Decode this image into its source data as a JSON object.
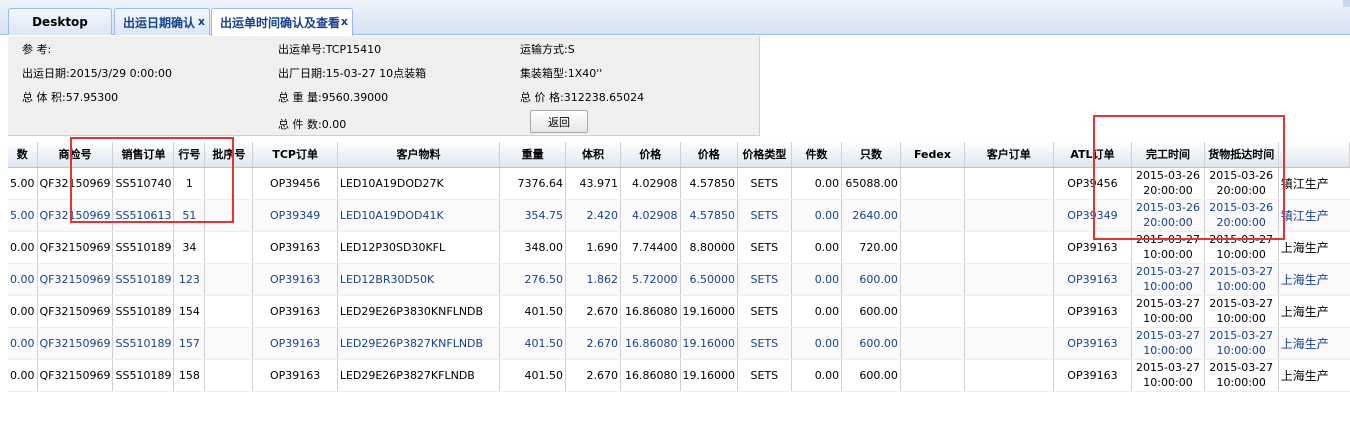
{
  "tabs": [
    {
      "label": "Desktop"
    },
    {
      "label": "出运日期确认",
      "close": "x"
    },
    {
      "label": "出运单时间确认及查看",
      "close": "x"
    }
  ],
  "info": {
    "ref_label": "参      考:",
    "ship_date": "出运日期:2015/3/29 0:00:00",
    "total_volume": "总 体 积:57.95300",
    "shipment_no": "出运单号:TCP15410",
    "factory_date": "出厂日期:15-03-27 10点装箱",
    "total_weight": "总 重 量:9560.39000",
    "total_pieces": "总 件 数:0.00",
    "transport": "运输方式:S",
    "container": "集装箱型:1X40''",
    "total_price": "总 价 格:312238.65024",
    "back_button": "返回"
  },
  "grid": {
    "headers": [
      "数",
      "商检号",
      "销售订单",
      "行号",
      "批序号",
      "TCP订单",
      "客户物料",
      "重量",
      "体积",
      "价格",
      "价格",
      "价格类型",
      "件数",
      "只数",
      "Fedex",
      "客户订单",
      "ATL订单",
      "完工时间",
      "货物抵达时间",
      ""
    ],
    "rows": [
      [
        "5.00",
        "QF32150969",
        "SS510740",
        "1",
        "",
        "OP39456",
        "LED10A19DOD27K",
        "7376.64",
        "43.971",
        "4.02908",
        "4.57850",
        "SETS",
        "0.00",
        "65088.00",
        "",
        "",
        "OP39456",
        "2015-03-26 20:00:00",
        "2015-03-26 20:00:00",
        "镇江生产"
      ],
      [
        "5.00",
        "QF32150969",
        "SS510613",
        "51",
        "",
        "OP39349",
        "LED10A19DOD41K",
        "354.75",
        "2.420",
        "4.02908",
        "4.57850",
        "SETS",
        "0.00",
        "2640.00",
        "",
        "",
        "OP39349",
        "2015-03-26 20:00:00",
        "2015-03-26 20:00:00",
        "镇江生产"
      ],
      [
        "0.00",
        "QF32150969",
        "SS510189",
        "34",
        "",
        "OP39163",
        "LED12P30SD30KFL",
        "348.00",
        "1.690",
        "7.74400",
        "8.80000",
        "SETS",
        "0.00",
        "720.00",
        "",
        "",
        "OP39163",
        "2015-03-27 10:00:00",
        "2015-03-27 10:00:00",
        "上海生产"
      ],
      [
        "0.00",
        "QF32150969",
        "SS510189",
        "123",
        "",
        "OP39163",
        "LED12BR30D50K",
        "276.50",
        "1.862",
        "5.72000",
        "6.50000",
        "SETS",
        "0.00",
        "600.00",
        "",
        "",
        "OP39163",
        "2015-03-27 10:00:00",
        "2015-03-27 10:00:00",
        "上海生产"
      ],
      [
        "0.00",
        "QF32150969",
        "SS510189",
        "154",
        "",
        "OP39163",
        "LED29E26P3830KNFLNDB",
        "401.50",
        "2.670",
        "16.86080",
        "19.16000",
        "SETS",
        "0.00",
        "600.00",
        "",
        "",
        "OP39163",
        "2015-03-27 10:00:00",
        "2015-03-27 10:00:00",
        "上海生产"
      ],
      [
        "0.00",
        "QF32150969",
        "SS510189",
        "157",
        "",
        "OP39163",
        "LED29E26P3827KNFLNDB",
        "401.50",
        "2.670",
        "16.86080",
        "19.16000",
        "SETS",
        "0.00",
        "600.00",
        "",
        "",
        "OP39163",
        "2015-03-27 10:00:00",
        "2015-03-27 10:00:00",
        "上海生产"
      ],
      [
        "0.00",
        "QF32150969",
        "SS510189",
        "158",
        "",
        "OP39163",
        "LED29E26P3827KFLNDB",
        "401.50",
        "2.670",
        "16.86080",
        "19.16000",
        "SETS",
        "0.00",
        "600.00",
        "",
        "",
        "OP39163",
        "2015-03-27 10:00:00",
        "2015-03-27 10:00:00",
        "上海生产"
      ]
    ]
  },
  "colors": {
    "accent": "#15428b",
    "highlight_border": "#e53333",
    "header_border": "#99bbe8"
  }
}
